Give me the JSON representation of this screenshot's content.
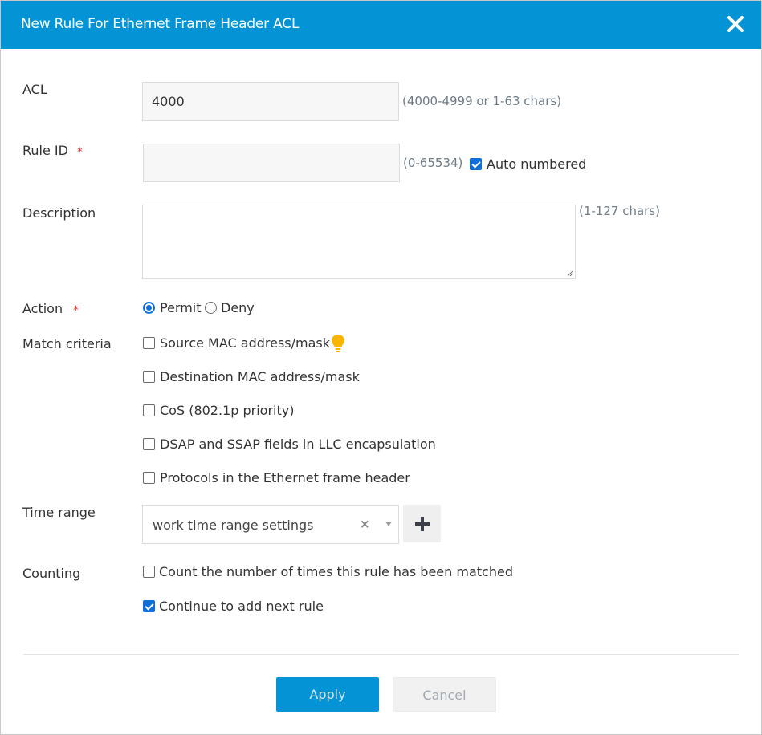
{
  "dialog": {
    "title": "New Rule For Ethernet Frame Header ACL",
    "close_icon": "close-icon"
  },
  "fields": {
    "acl": {
      "label": "ACL",
      "value": "4000",
      "hint": "(4000-4999 or 1-63 chars)"
    },
    "rule_id": {
      "label": "Rule ID",
      "required_mark": "*",
      "value": "",
      "hint": "(0-65534)",
      "auto_label": "Auto numbered",
      "auto_checked": true
    },
    "description": {
      "label": "Description",
      "value": "",
      "hint": "(1-127 chars)"
    },
    "action": {
      "label": "Action",
      "required_mark": "*",
      "options": [
        "Permit",
        "Deny"
      ],
      "selected": "Permit"
    },
    "match_criteria": {
      "label": "Match criteria",
      "options": [
        "Source MAC address/mask",
        "Destination MAC address/mask",
        "CoS (802.1p priority)",
        "DSAP and SSAP fields in LLC encapsulation",
        "Protocols in the Ethernet frame header"
      ],
      "tip_icon": "lightbulb-icon"
    },
    "time_range": {
      "label": "Time range",
      "value": "work time range settings",
      "clear_glyph": "×"
    },
    "counting": {
      "label": "Counting",
      "count_label": "Count the number of times this rule has been matched",
      "count_checked": false
    },
    "continue": {
      "label": "Continue to add next rule",
      "checked": true
    }
  },
  "buttons": {
    "apply": "Apply",
    "cancel": "Cancel"
  },
  "colors": {
    "header": "#0494d6",
    "required": "#e0352b",
    "check": "#0f6fd8",
    "hint": "#6f7b86"
  }
}
